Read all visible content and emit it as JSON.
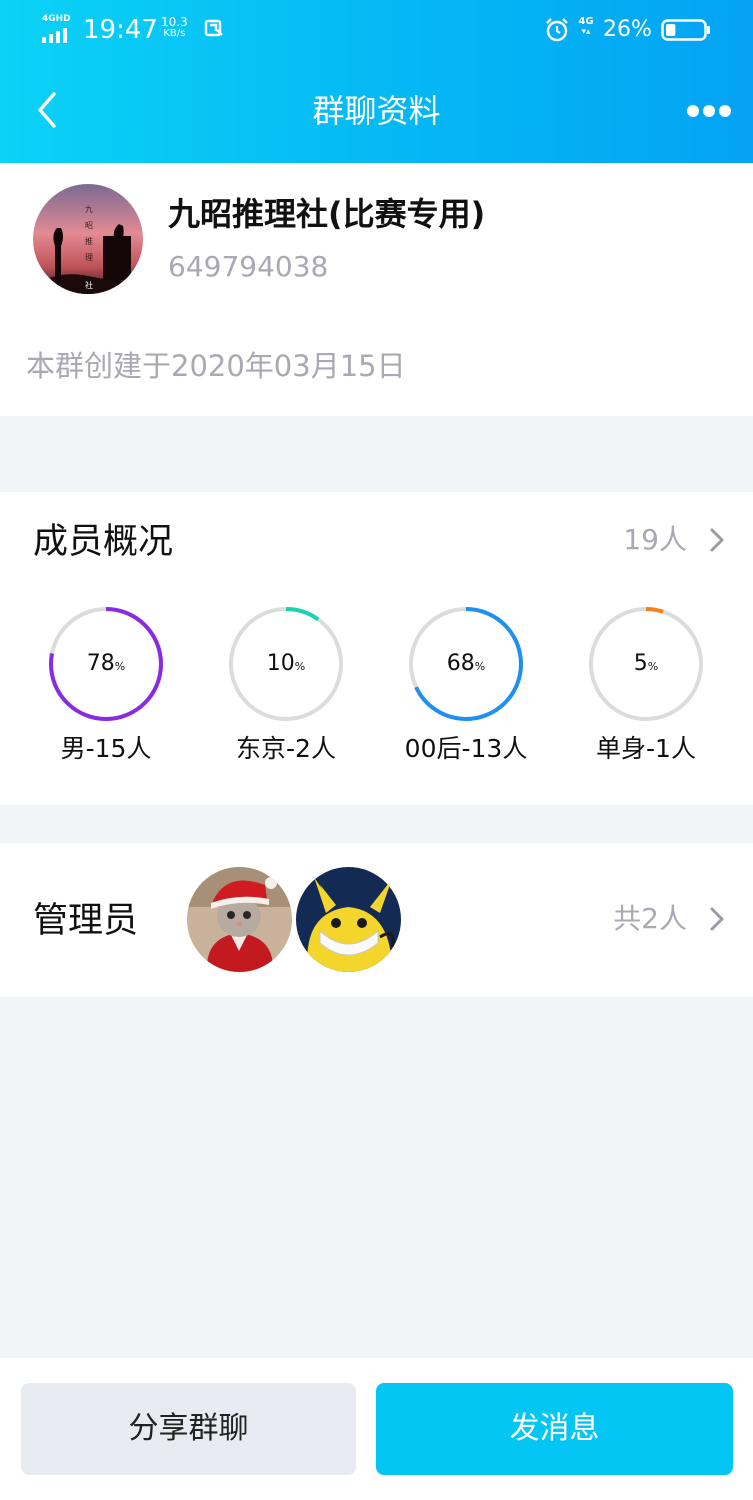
{
  "status_bar": {
    "network_type": "4GHD",
    "time": "19:47",
    "speed_value": "10.3",
    "speed_unit": "KB/s",
    "signal_4g": "4G",
    "battery_percent": "26%",
    "battery_level": 0.26
  },
  "nav": {
    "title": "群聊资料",
    "icons": [
      "back-icon",
      "more-icon"
    ]
  },
  "group": {
    "name": "九昭推理社(比赛专用)",
    "id": "649794038",
    "created": "本群创建于2020年03月15日"
  },
  "members": {
    "title": "成员概况",
    "count": "19人",
    "stats": [
      {
        "percent": 78,
        "percent_text": "78",
        "unit": "%",
        "label": "男-15人",
        "color": "#8a2be2"
      },
      {
        "percent": 10,
        "percent_text": "10",
        "unit": "%",
        "label": "东京-2人",
        "color": "#19d3b0"
      },
      {
        "percent": 68,
        "percent_text": "68",
        "unit": "%",
        "label": "00后-13人",
        "color": "#1e90f0"
      },
      {
        "percent": 5,
        "percent_text": "5",
        "unit": "%",
        "label": "单身-1人",
        "color": "#f5821f"
      }
    ]
  },
  "admins": {
    "title": "管理员",
    "count": "共2人"
  },
  "buttons": {
    "share": "分享群聊",
    "send": "发消息"
  },
  "colors": {
    "header_start": "#0bd2f6",
    "header_end": "#04a3f3",
    "send_button": "#03c6f4",
    "share_button": "#e9ebf3",
    "page_background": "#f3f4f8"
  }
}
